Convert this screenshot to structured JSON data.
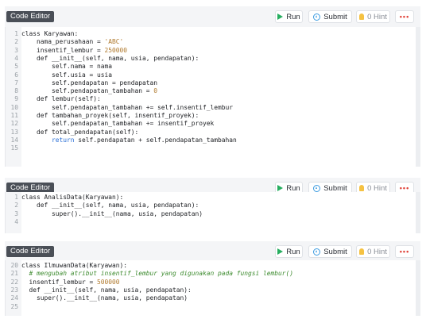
{
  "toolbar": {
    "tag": "Code Editor",
    "run_label": "Run",
    "submit_label": "Submit",
    "hint_label": "0 Hint",
    "more_label": "•••"
  },
  "panels": [
    {
      "lines": [
        {
          "n": "1",
          "segs": [
            [
              "plain",
              "class Karyawan:"
            ]
          ]
        },
        {
          "n": "2",
          "segs": [
            [
              "plain",
              "    nama_perusahaan = "
            ],
            [
              "str",
              "'ABC'"
            ]
          ]
        },
        {
          "n": "3",
          "segs": [
            [
              "plain",
              "    insentif_lembur = "
            ],
            [
              "num",
              "250000"
            ]
          ]
        },
        {
          "n": "4",
          "segs": [
            [
              "plain",
              "    def __init__(self, nama, usia, pendapatan):"
            ]
          ]
        },
        {
          "n": "5",
          "segs": [
            [
              "plain",
              "        self.nama = nama"
            ]
          ]
        },
        {
          "n": "6",
          "segs": [
            [
              "plain",
              "        self.usia = usia"
            ]
          ]
        },
        {
          "n": "7",
          "segs": [
            [
              "plain",
              "        self.pendapatan = pendapatan"
            ]
          ]
        },
        {
          "n": "8",
          "segs": [
            [
              "plain",
              "        self.pendapatan_tambahan = "
            ],
            [
              "num",
              "0"
            ]
          ]
        },
        {
          "n": "9",
          "segs": [
            [
              "plain",
              "    def lembur(self):"
            ]
          ]
        },
        {
          "n": "10",
          "segs": [
            [
              "plain",
              "        self.pendapatan_tambahan += self.insentif_lembur"
            ]
          ]
        },
        {
          "n": "11",
          "segs": [
            [
              "plain",
              "    def tambahan_proyek(self, insentif_proyek):"
            ]
          ]
        },
        {
          "n": "12",
          "segs": [
            [
              "plain",
              "        self.pendapatan_tambahan += insentif_proyek"
            ]
          ]
        },
        {
          "n": "13",
          "segs": [
            [
              "plain",
              "    def total_pendapatan(self):"
            ]
          ]
        },
        {
          "n": "14",
          "segs": [
            [
              "plain",
              "        "
            ],
            [
              "ret",
              "return"
            ],
            [
              "plain",
              " self.pendapatan + self.pendapatan_tambahan"
            ]
          ]
        },
        {
          "n": "15",
          "segs": [
            [
              "plain",
              ""
            ]
          ]
        }
      ]
    },
    {
      "lines": [
        {
          "n": "1",
          "segs": [
            [
              "plain",
              "class AnalisData(Karyawan):"
            ]
          ]
        },
        {
          "n": "2",
          "segs": [
            [
              "plain",
              "    def __init__(self, nama, usia, pendapatan):"
            ]
          ]
        },
        {
          "n": "3",
          "segs": [
            [
              "plain",
              "        super().__init__(nama, usia, pendapatan)"
            ]
          ]
        },
        {
          "n": "4",
          "segs": [
            [
              "plain",
              ""
            ]
          ]
        }
      ]
    },
    {
      "lines": [
        {
          "n": "20",
          "segs": [
            [
              "plain",
              "class IlmuwanData(Karyawan):"
            ]
          ]
        },
        {
          "n": "21",
          "segs": [
            [
              "plain",
              "  "
            ],
            [
              "cm",
              "# mengubah atribut insentif_lembur yang digunakan pada fungsi lembur()"
            ]
          ]
        },
        {
          "n": "22",
          "segs": [
            [
              "plain",
              "  insentif_lembur = "
            ],
            [
              "num",
              "500000"
            ]
          ]
        },
        {
          "n": "23",
          "segs": [
            [
              "plain",
              "  def __init__(self, nama, usia, pendapatan):"
            ]
          ]
        },
        {
          "n": "24",
          "segs": [
            [
              "plain",
              "    super().__init__(nama, usia, pendapatan)"
            ]
          ]
        },
        {
          "n": "25",
          "segs": [
            [
              "plain",
              ""
            ]
          ]
        }
      ]
    }
  ]
}
